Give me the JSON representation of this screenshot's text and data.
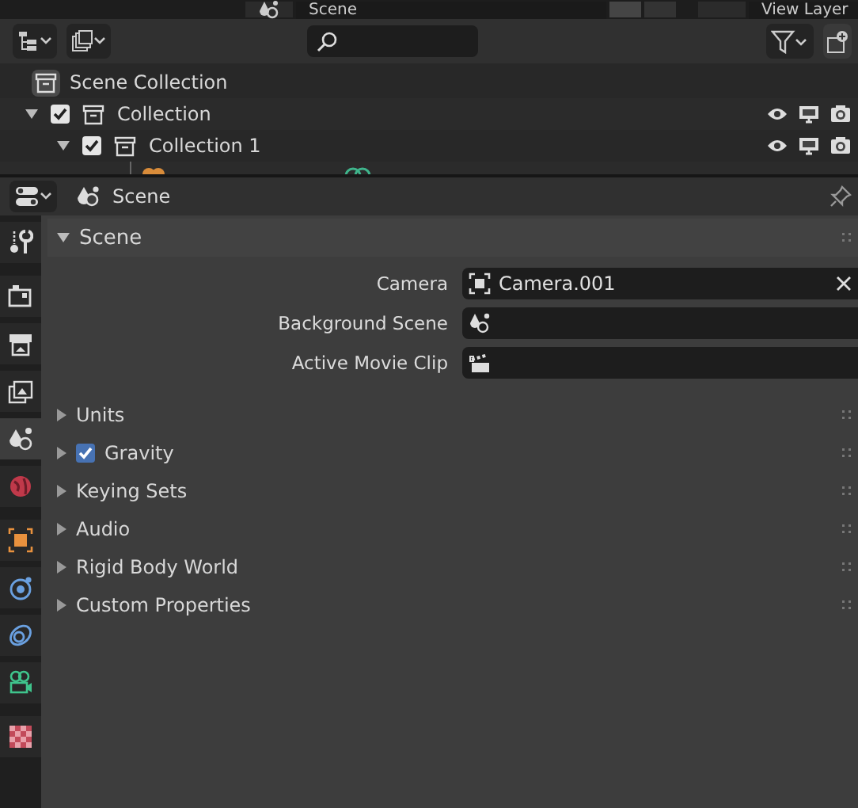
{
  "top_bar": {
    "scene_field": "Scene",
    "view_layer_field": "View Layer"
  },
  "outliner": {
    "rows": [
      {
        "label": "Scene Collection",
        "kind": "scene_collection",
        "children": [
          {
            "label": "Collection",
            "kind": "collection",
            "expanded": true,
            "checked": true,
            "children": [
              {
                "label": "Collection 1",
                "kind": "collection",
                "expanded": true,
                "checked": true
              }
            ]
          }
        ]
      }
    ]
  },
  "properties": {
    "header": {
      "title": "Scene"
    },
    "tabs": [
      {
        "kind": "tool",
        "selected": false
      },
      {
        "kind": "render",
        "selected": false
      },
      {
        "kind": "output",
        "selected": false
      },
      {
        "kind": "view_layer",
        "selected": false
      },
      {
        "kind": "scene",
        "selected": true
      },
      {
        "kind": "world",
        "selected": false
      },
      {
        "kind": "object",
        "selected": false
      },
      {
        "kind": "physics",
        "selected": false
      },
      {
        "kind": "constraints",
        "selected": false
      },
      {
        "kind": "camera",
        "selected": false
      },
      {
        "kind": "texture",
        "selected": false
      }
    ],
    "panels": [
      {
        "title": "Scene",
        "expanded": true,
        "fields": [
          {
            "label": "Camera",
            "kind": "camera",
            "value": "Camera.001",
            "clearable": true
          },
          {
            "label": "Background Scene",
            "kind": "scene",
            "clearable": false
          },
          {
            "label": "Active Movie Clip",
            "kind": "clip",
            "clearable": false
          }
        ]
      },
      {
        "title": "Units",
        "expanded": false
      },
      {
        "title": "Gravity",
        "expanded": false,
        "checked": true
      },
      {
        "title": "Keying Sets",
        "expanded": false
      },
      {
        "title": "Audio",
        "expanded": false
      },
      {
        "title": "Rigid Body World",
        "expanded": false
      },
      {
        "title": "Custom Properties",
        "expanded": false
      }
    ]
  }
}
